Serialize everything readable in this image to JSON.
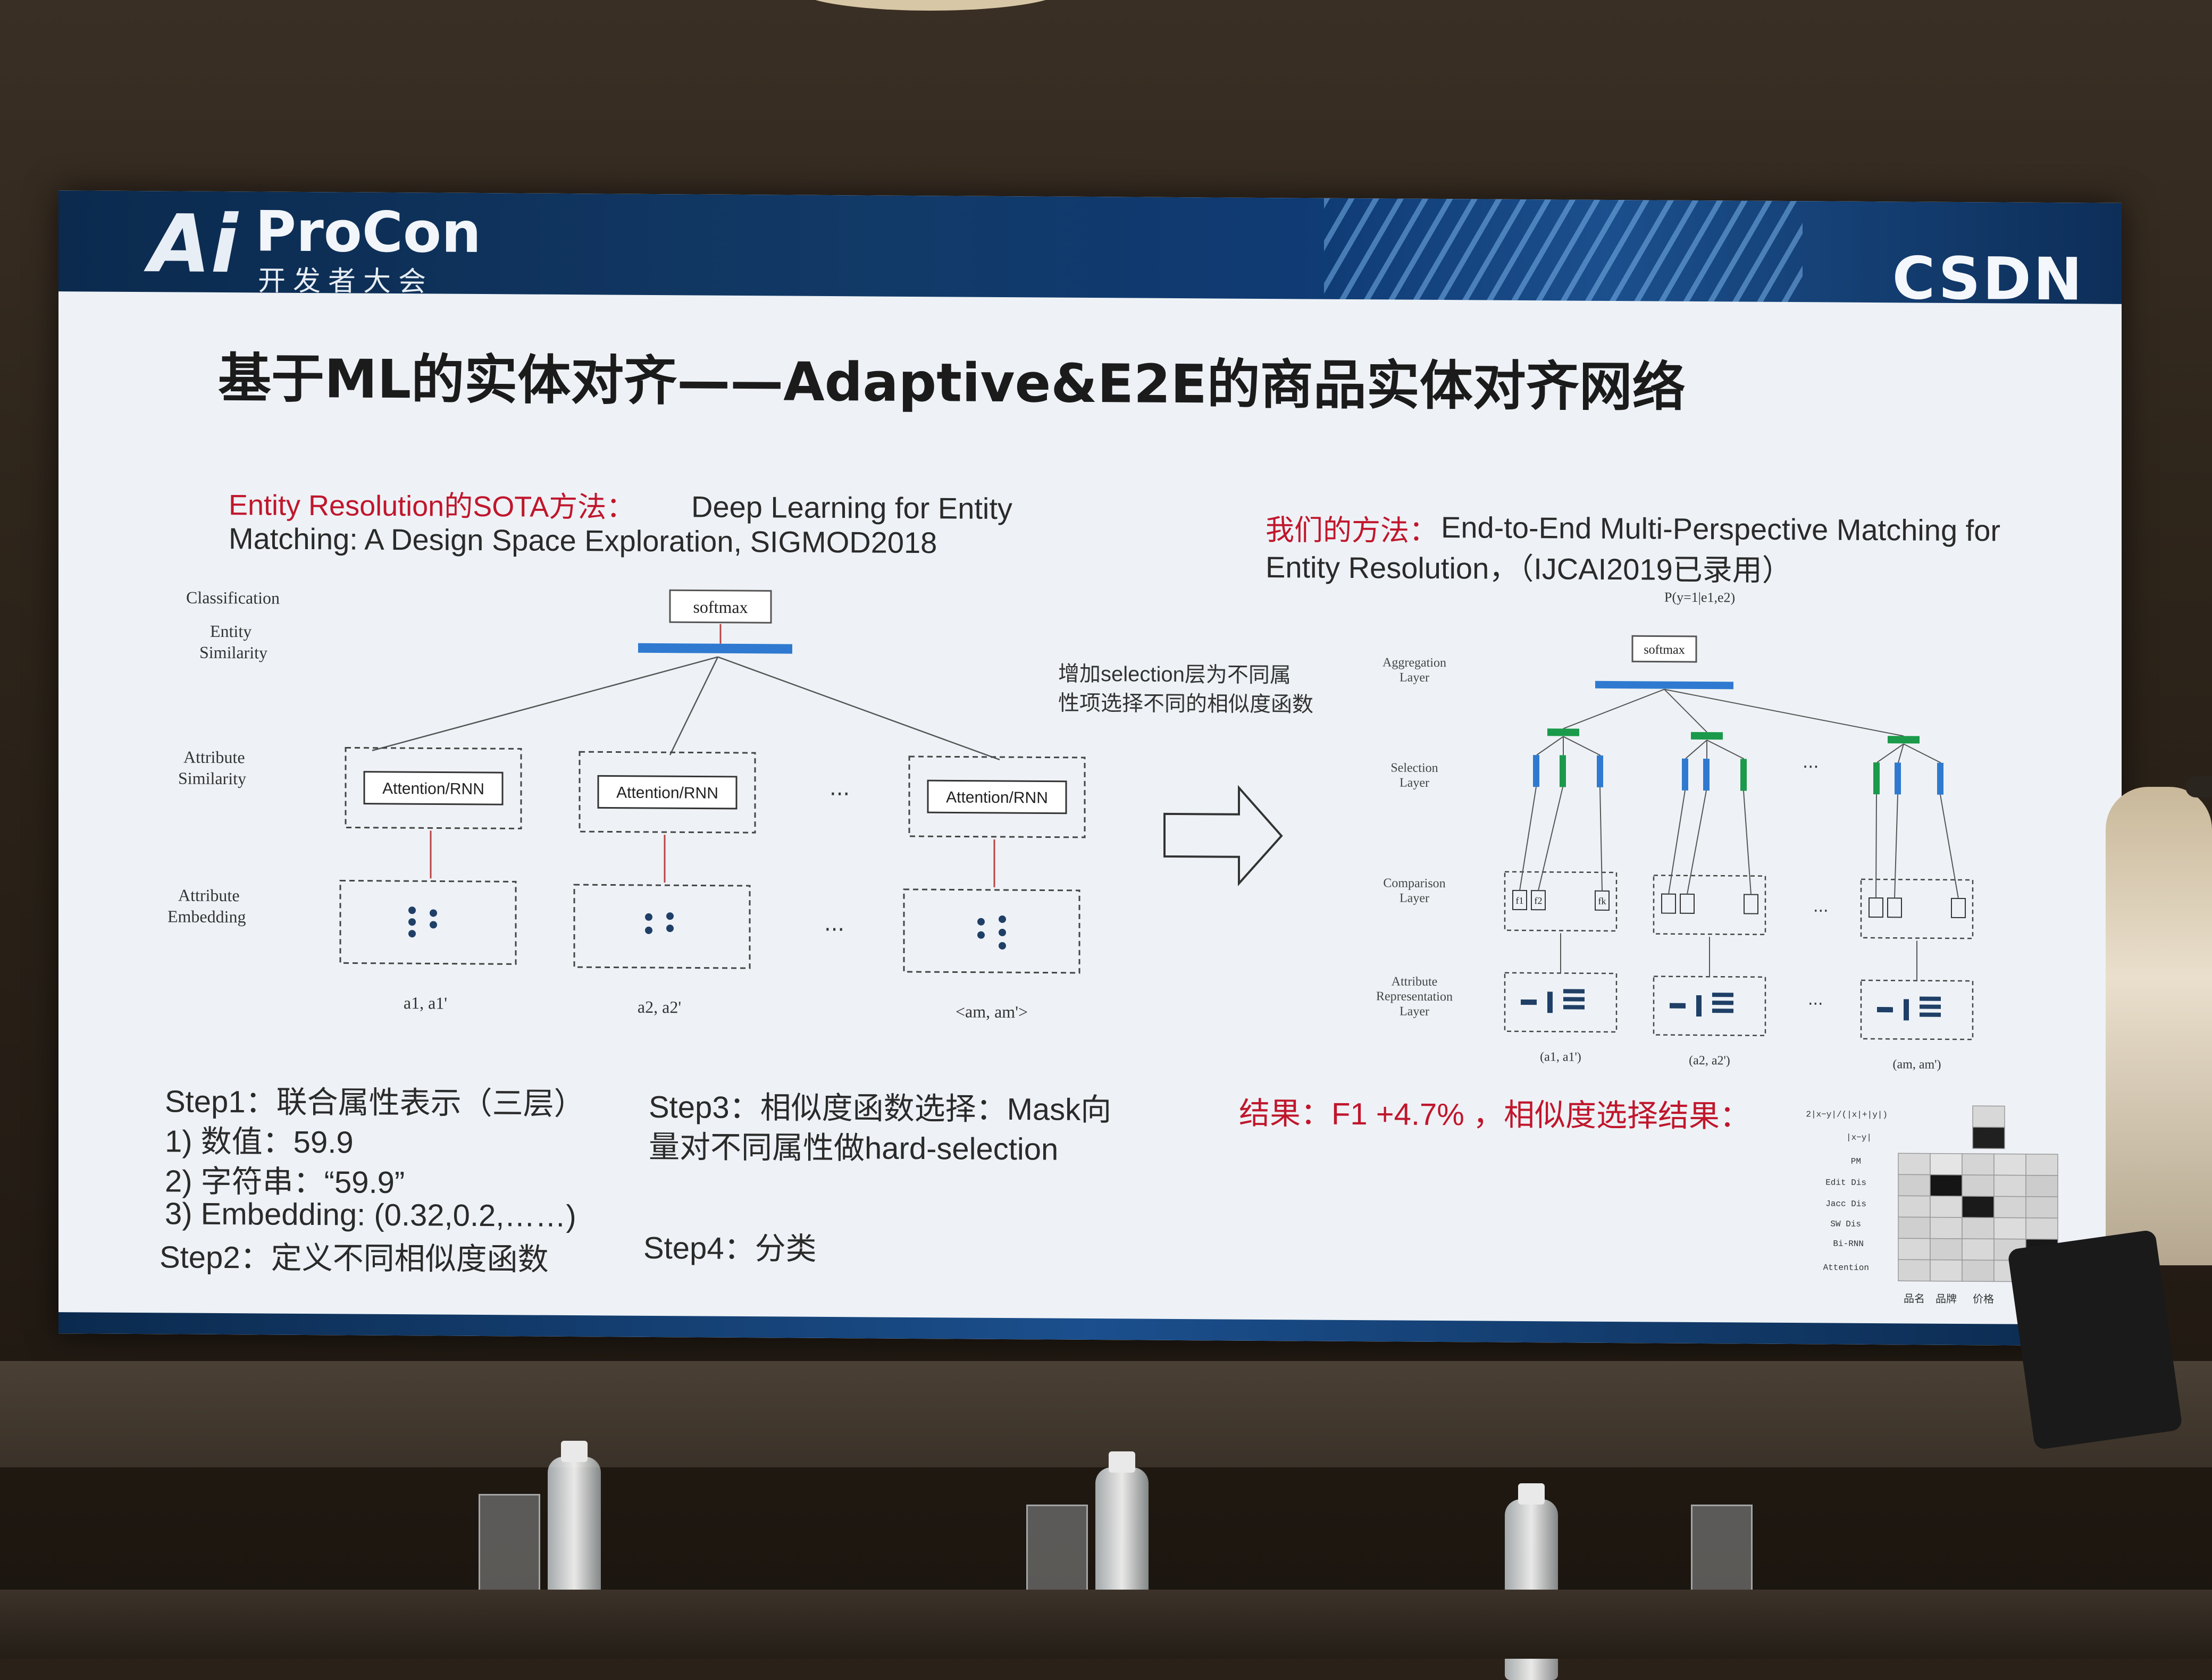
{
  "header": {
    "logo_ai": "Ai",
    "logo_procon": "ProCon",
    "logo_sub": "开发者大会",
    "logo_right": "CSDN"
  },
  "title": "基于ML的实体对齐——Adaptive&E2E的商品实体对齐网络",
  "left": {
    "ref_prefix": "Entity Resolution的SOTA方法：",
    "ref_line1": "Deep Learning for Entity",
    "ref_line2": "Matching: A Design Space Exploration, SIGMOD2018",
    "diagram": {
      "row_labels": [
        "Classification",
        "Entity",
        "Similarity",
        "Attribute",
        "Similarity",
        "Attribute",
        "Embedding"
      ],
      "softmax": "softmax",
      "blocks": [
        "Attention/RNN",
        "Attention/RNN",
        "Attention/RNN"
      ],
      "ellipsis": "···",
      "inputs": [
        "a1, a1'",
        "a2, a2'",
        "<am, am'>"
      ]
    }
  },
  "middle_note": {
    "line1": "增加selection层为不同属",
    "line2": "性项选择不同的相似度函数"
  },
  "right": {
    "method_prefix": "我们的方法：",
    "method_line1": "End-to-End Multi-Perspective Matching for",
    "method_line2": "Entity Resolution，（IJCAI2019已录用）",
    "diagram": {
      "top_label": "P(y=1|e1,e2)",
      "softmax": "softmax",
      "layer_labels": [
        "Aggregation",
        "Layer",
        "Selection",
        "Layer",
        "Comparison",
        "Layer",
        "Attribute",
        "Representation",
        "Layer"
      ],
      "ellipsis": "···",
      "f_labels": [
        "f1",
        "f2",
        "fk"
      ],
      "inputs": [
        "(a1, a1')",
        "(a2, a2')",
        "(am, am')"
      ]
    }
  },
  "steps": {
    "step1": "Step1：联合属性表示（三层）",
    "item1": "1) 数值：59.9",
    "item2": "2) 字符串：“59.9”",
    "item3": "3) Embedding: (0.32,0.2,……)",
    "step2": "Step2：定义不同相似度函数",
    "step3_line1": "Step3：相似度函数选择：Mask向",
    "step3_line2": "量对不同属性做hard-selection",
    "step4": "Step4：分类"
  },
  "result": {
    "text": "结果：F1 +4.7% ，相似度选择结果：",
    "heatmap_row_labels": [
      "2|x−y|/(|x|+|y|)",
      "|x−y|",
      "PM",
      "Edit Dis",
      "Jacc Dis",
      "SW Dis",
      "Bi-RNN",
      "Attention"
    ],
    "heatmap_col_labels": [
      "品名",
      "品牌",
      "价格"
    ]
  }
}
